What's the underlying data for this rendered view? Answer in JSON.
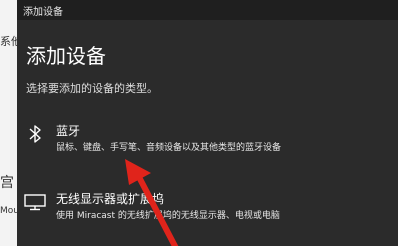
{
  "background_window": {
    "text_1": "系他",
    "text_2": "宫",
    "text_3": "Mou"
  },
  "dialog": {
    "window_title": "添加设备",
    "heading": "添加设备",
    "subtitle": "选择要添加的设备的类型。",
    "options": [
      {
        "icon": "bluetooth-icon",
        "title": "蓝牙",
        "description": "鼠标、键盘、手写笔、音频设备以及其他类型的蓝牙设备"
      },
      {
        "icon": "monitor-icon",
        "title": "无线显示器或扩展坞",
        "description": "使用 Miracast 的无线扩展坞的无线显示器、电视或电脑"
      }
    ]
  },
  "annotation": {
    "arrow_color": "#e0241b"
  },
  "colors": {
    "dialog_background": "#2b2b2b",
    "titlebar_background": "#1f1f1f",
    "text": "#ffffff"
  }
}
